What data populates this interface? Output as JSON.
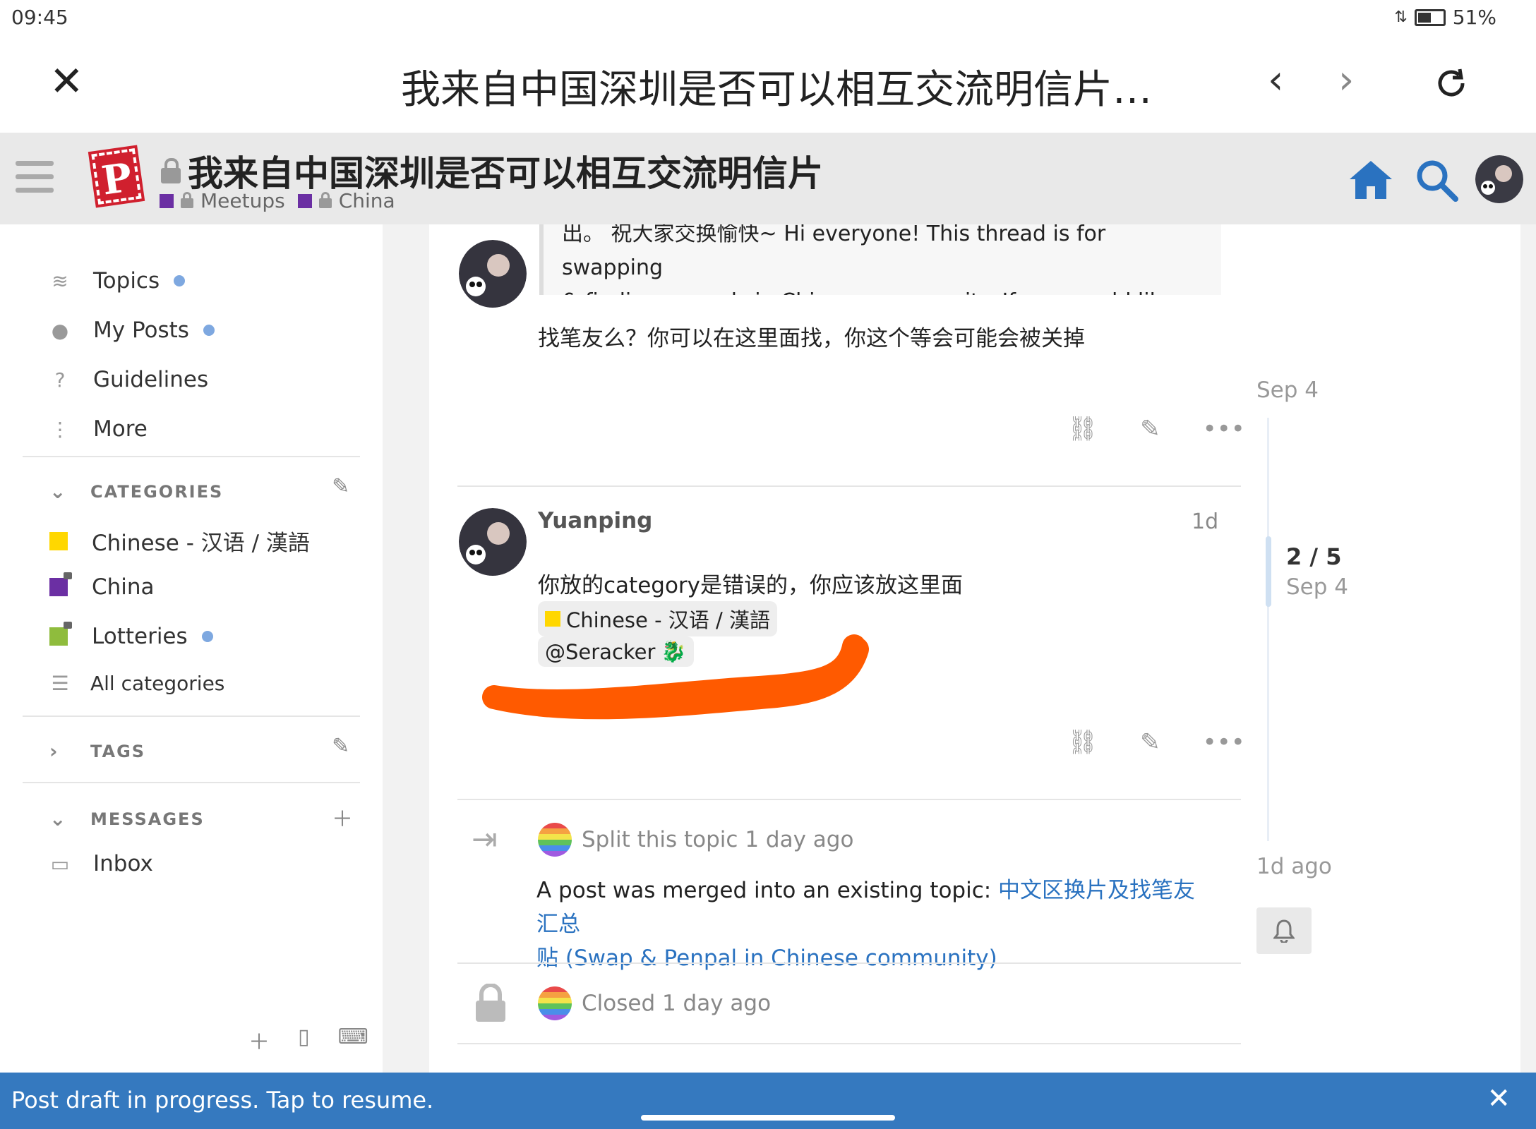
{
  "status": {
    "time": "09:45",
    "battery": "51%"
  },
  "browser": {
    "title": "我来自中国深圳是否可以相互交流明信片…"
  },
  "header": {
    "topic_title": "我来自中国深圳是否可以相互交流明信片",
    "category1": "Meetups",
    "category2": "China",
    "colors": {
      "meetups": "#6b2fa3",
      "china": "#6b2fa3",
      "home": "#2a72c0"
    }
  },
  "sidebar": {
    "items": [
      {
        "label": "Topics"
      },
      {
        "label": "My Posts"
      },
      {
        "label": "Guidelines"
      },
      {
        "label": "More"
      }
    ],
    "categories_title": "CATEGORIES",
    "categories": [
      {
        "label": "Chinese - 汉语 / 漢語",
        "color": "#ffd700"
      },
      {
        "label": "China",
        "color": "#6b2fa3"
      },
      {
        "label": "Lotteries",
        "color": "#8fbc3d"
      },
      {
        "label": "All categories"
      }
    ],
    "tags_title": "TAGS",
    "messages_title": "MESSAGES",
    "inbox": "Inbox"
  },
  "posts": {
    "quote_line1": "出。 祝大家交换愉快~ Hi everyone! This thread is for swapping",
    "quote_line2": "& finding penpals in Chinese community. If you would lik…",
    "post1_text": "找笔友么？你可以在这里面找，你这个等会可能会被关掉",
    "post2_user": "Yuanping",
    "post2_date": "1d",
    "post2_text": "你放的category是错误的，你应该放这里面",
    "post2_chip_category": "Chinese - 汉语 / 漢語",
    "post2_chip_mention": "@Seracker",
    "split_text": "Split this topic 1 day ago",
    "merged_prefix": "A post was merged into an existing topic: ",
    "merged_link_line1": "中文区换片及找笔友汇总",
    "merged_link_line2": "贴 (Swap & Penpal in Chinese community)",
    "closed_text": "Closed 1 day ago"
  },
  "timeline": {
    "top_date": "Sep 4",
    "count": "2 / 5",
    "current_date": "Sep 4",
    "bottom": "1d ago"
  },
  "banner": {
    "text": "Post draft in progress. Tap to resume."
  }
}
